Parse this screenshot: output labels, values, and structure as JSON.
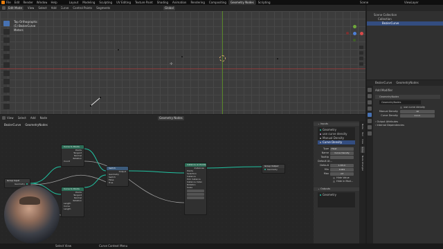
{
  "topbar": {
    "menus": [
      "File",
      "Edit",
      "Render",
      "Window",
      "Help"
    ],
    "workspaces": [
      "Layout",
      "Modeling",
      "Sculpting",
      "UV Editing",
      "Texture Paint",
      "Shading",
      "Animation",
      "Rendering",
      "Compositing",
      "Geometry Nodes",
      "Scripting"
    ],
    "active_workspace": "Geometry Nodes",
    "scene": "Scene",
    "view_layer": "ViewLayer"
  },
  "viewport_header": {
    "mode": "Edit Mode",
    "menus": [
      "View",
      "Select",
      "Add",
      "Curve",
      "Control Points",
      "Segments"
    ],
    "orientation": "Global"
  },
  "viewport": {
    "info_line1": "Top Orthographic",
    "info_line2": "(1) BezierCurve",
    "info_line3": "Meters"
  },
  "outliner": {
    "items": [
      "Scene Collection",
      "Collection",
      "BezierCurve"
    ]
  },
  "properties": {
    "breadcrumb_object": "BezierCurve",
    "breadcrumb_modifier": "GeometryNodes",
    "add_modifier": "Add Modifier",
    "modifier_name": "GeometryNodes",
    "node_group": "GeometryNodes",
    "use_curve_density_label": "use curve density",
    "manual_density_label": "Manual Density",
    "manual_density_value": "10",
    "curve_density_label": "Curve Density",
    "curve_density_value": "2.2 m",
    "output_attributes": "Output Attributes",
    "internal_dependencies": "Internal Dependencies"
  },
  "node_header": {
    "menus": [
      "View",
      "Select",
      "Add",
      "Node"
    ],
    "tree_name": "Geometry Nodes",
    "breadcrumb_object": "BezierCurve",
    "breadcrumb_tree": "GeometryNodes"
  },
  "nodes": {
    "group_input": {
      "title": "Group Input",
      "sockets": [
        "Geometry"
      ]
    },
    "curve_to_points_1": {
      "title": "Curve to Points",
      "outputs": [
        "Points",
        "Tangent",
        "Normal",
        "Rotation"
      ],
      "inputs": [
        "Count"
      ]
    },
    "curve_to_points_2": {
      "title": "Curve to Points",
      "outputs": [
        "Points",
        "Tangent",
        "Normal",
        "Rotation"
      ],
      "inputs": [
        "Length",
        "Curve",
        "Length"
      ]
    },
    "switch": {
      "title": "Switch",
      "sockets": [
        "Output",
        "Geometry",
        "Switch",
        "False",
        "True"
      ]
    },
    "instance_on_points": {
      "title": "Instance on Points",
      "sockets": [
        "Instances",
        "Points",
        "Selection",
        "Instance",
        "Pick Instance",
        "Instance Index",
        "Rotation",
        "Scale"
      ]
    },
    "group_output": {
      "title": "Group Output",
      "sockets": [
        "Geometry"
      ]
    }
  },
  "sidebar": {
    "inputs_title": "Inputs",
    "socket_list": [
      "Geometry",
      "use curve density",
      "Manual Density",
      "Curve Density"
    ],
    "type_label": "Type",
    "type_value": "Float",
    "name_label": "Name",
    "name_value": "Curve Density",
    "tooltip_label": "Tooltip",
    "default_attr_label": "Default At...",
    "default_label": "Default",
    "default_value": "1.33 m",
    "min_label": "Min",
    "min_value": "0.001",
    "max_label": "Max",
    "max_value": "inf",
    "hide_value": "Hide Value",
    "hide_in_mod": "Hide in Mod...",
    "outputs_title": "Outputs",
    "output_socket": "Geometry",
    "tabs": [
      "Node",
      "Tool",
      "View",
      "Group",
      "Node Wrangler"
    ]
  },
  "status": {
    "left": "Select View",
    "middle": "Curve Context Menu"
  }
}
